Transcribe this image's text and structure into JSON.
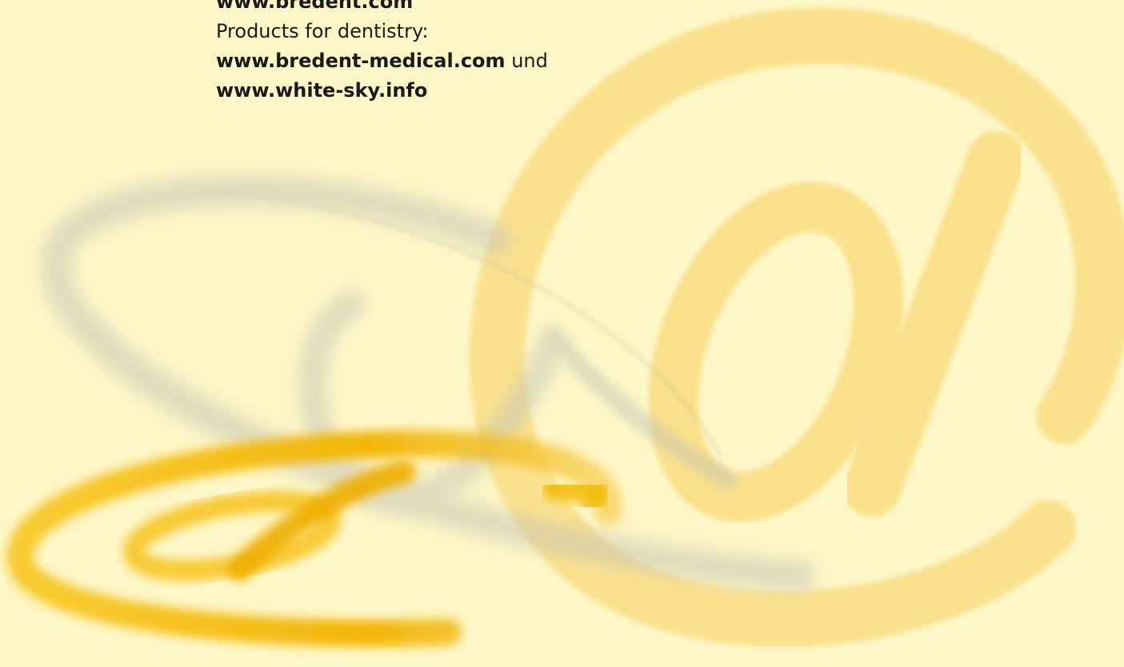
{
  "links": {
    "bredent": "www.bredent.com",
    "dentistry_label": "Products for dentistry:",
    "bredent_medical": "www.bredent-medical.com",
    "conjunction": "und",
    "white_sky": "www.white-sky.info"
  },
  "artwork": {
    "large_symbol": "@",
    "small_symbol": "@",
    "icon": "at-sign-icon",
    "colors": {
      "background": "#fdf6c6",
      "large_at": "#fae08a",
      "small_at": "#f2b900",
      "shadow": "#c8c6b6"
    }
  }
}
